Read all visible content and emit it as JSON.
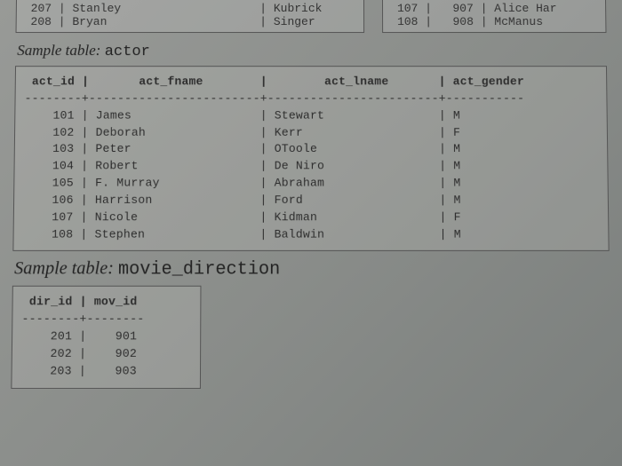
{
  "top_fragment_left": {
    "row1": " 207 | Stanley                    | Kubrick",
    "row2": " 208 | Bryan                      | Singer"
  },
  "top_fragment_right": {
    "row1": " 107 |   907 | Alice Har",
    "row2": " 108 |   908 | McManus"
  },
  "actor_section": {
    "title_prefix": "Sample table",
    "title_name": "actor",
    "header": " act_id |       act_fname        |        act_lname       | act_gender",
    "divider": "--------+------------------------+------------------------+-----------",
    "rows": [
      "    101 | James                  | Stewart                | M",
      "    102 | Deborah                | Kerr                   | F",
      "    103 | Peter                  | OToole                 | M",
      "    104 | Robert                 | De Niro                | M",
      "    105 | F. Murray              | Abraham                | M",
      "    106 | Harrison               | Ford                   | M",
      "    107 | Nicole                 | Kidman                 | F",
      "    108 | Stephen                | Baldwin                | M"
    ]
  },
  "movdir_section": {
    "title_prefix": "Sample table",
    "title_name": "movie_direction",
    "header": " dir_id | mov_id",
    "divider": "--------+--------",
    "rows": [
      "    201 |    901",
      "    202 |    902",
      "    203 |    903"
    ]
  }
}
